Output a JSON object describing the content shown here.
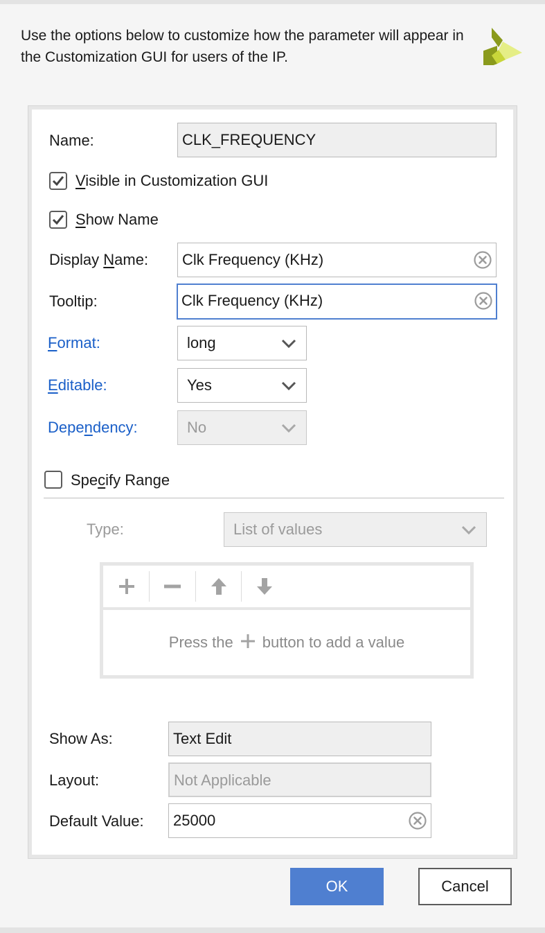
{
  "intro": {
    "text": "Use the options below to customize how the parameter will appear in the Customization GUI for users of the IP."
  },
  "logo": {
    "icon": "xilinx-logo-icon",
    "colors": [
      "#8a9a1c",
      "#c8d63a",
      "#e5ee86"
    ]
  },
  "form": {
    "name": {
      "label": "Name:",
      "value": "CLK_FREQUENCY"
    },
    "visible": {
      "label_u": "V",
      "label_rest": "isible in Customization GUI",
      "checked": true
    },
    "show_name": {
      "label_u": "S",
      "label_rest": "how Name",
      "checked": true
    },
    "display_name": {
      "label_pre": "Display ",
      "label_u": "N",
      "label_rest": "ame:",
      "value": "Clk Frequency (KHz)"
    },
    "tooltip": {
      "label": "Tooltip:",
      "value": "Clk Frequency (KHz)"
    },
    "format": {
      "label_u": "F",
      "label_rest": "ormat:",
      "value": "long"
    },
    "editable": {
      "label_u": "E",
      "label_rest": "ditable:",
      "value": "Yes"
    },
    "dependency": {
      "label_pre": "Depe",
      "label_u": "n",
      "label_rest": "dency:",
      "value": "No"
    },
    "specify_range": {
      "label_pre": "Spe",
      "label_u": "c",
      "label_rest": "ify Range",
      "checked": false
    },
    "range_type": {
      "label": "Type:",
      "value": "List of values"
    },
    "list_hint": {
      "before": "Press the",
      "after": "button to add a value"
    },
    "show_as": {
      "label": "Show As:",
      "value": "Text Edit"
    },
    "layout": {
      "label": "Layout:",
      "value": "Not Applicable"
    },
    "default_value": {
      "label": "Default Value:",
      "value": "25000"
    }
  },
  "buttons": {
    "ok": "OK",
    "cancel": "Cancel"
  },
  "colors": {
    "accent": "#4f7fd0",
    "link_label": "#1a5fc8",
    "disabled_text": "#9a9a9a"
  }
}
